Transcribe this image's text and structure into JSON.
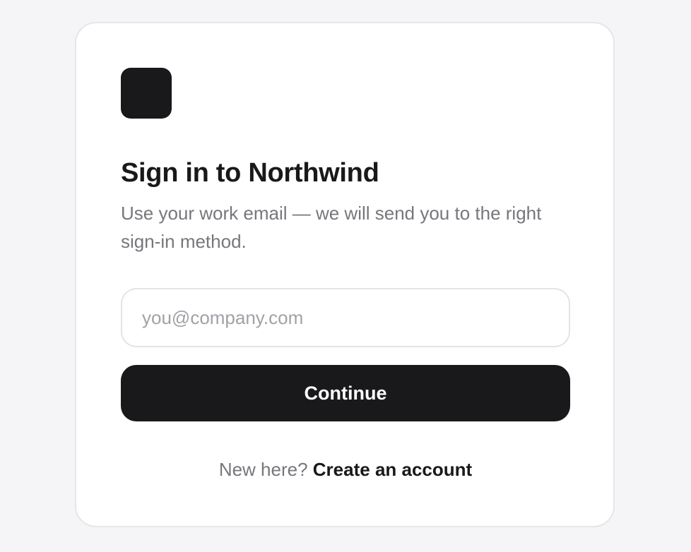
{
  "signin": {
    "title": "Sign in to Northwind",
    "subtitle": "Use your work email — we will send you to the right sign-in method.",
    "email_placeholder": "you@company.com",
    "email_value": "",
    "continue_label": "Continue",
    "footer_prompt": "New here?",
    "footer_link": "Create an account"
  },
  "colors": {
    "background": "#f5f4f7",
    "card": "#ffffff",
    "primary": "#19181b",
    "muted_text": "#77767c",
    "placeholder": "#a2a1a8",
    "border": "#e6e5ea"
  },
  "icons": {
    "logo": "brand-logo-icon"
  }
}
